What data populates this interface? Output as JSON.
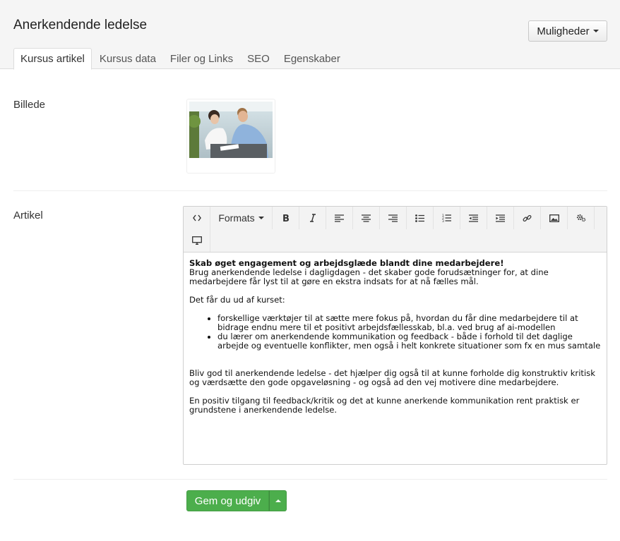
{
  "page": {
    "title": "Anerkendende ledelse",
    "options_label": "Muligheder"
  },
  "tabs": [
    {
      "label": "Kursus artikel",
      "active": true
    },
    {
      "label": "Kursus data"
    },
    {
      "label": "Filer og Links"
    },
    {
      "label": "SEO"
    },
    {
      "label": "Egenskaber"
    }
  ],
  "fields": {
    "image_label": "Billede",
    "article_label": "Artikel"
  },
  "editor": {
    "toolbar": {
      "row1": [
        "code-icon",
        "formats-dropdown",
        "bold-icon",
        "italic-icon",
        "align-left-icon",
        "align-center-icon",
        "align-right-icon",
        "bullet-list-icon",
        "numbered-list-icon",
        "outdent-icon",
        "indent-icon",
        "link-icon",
        "image-icon",
        "settings-icon"
      ],
      "row2": [
        "preview-icon"
      ],
      "formats_label": "Formats"
    },
    "content": {
      "heading": "Skab øget engagement og arbejdsglæde blandt dine medarbejdere!",
      "intro": "Brug anerkendende ledelse i dagligdagen - det skaber gode forudsætninger for, at dine medarbejdere får lyst til at gøre en ekstra indsats for at nå fælles mål.",
      "what_you_get": "Det får du ud af kurset:",
      "bullets": [
        "forskellige værktøjer til at sætte mere fokus på, hvordan du får dine medarbejdere til at bidrage endnu mere til et positivt arbejdsfællesskab, bl.a. ved brug af ai-modellen",
        "du lærer om anerkendende kommunikation og feedback - både i forhold til det daglige arbejde og eventuelle konflikter, men også i helt konkrete situationer som fx en mus samtale"
      ],
      "para1": "Bliv god til anerkendende ledelse - det hjælper dig også til at kunne forholde dig konstruktiv kritisk og værdsætte den gode opgaveløsning - og også ad den vej motivere dine medarbejdere.",
      "para2": "En positiv tilgang til feedback/kritik og det at kunne anerkende kommunikation rent praktisk er grundstene i anerkendende ledelse."
    }
  },
  "actions": {
    "save_label": "Gem og udgiv"
  },
  "colors": {
    "primary_green": "#4cae4c",
    "header_bg": "#f5f5f5"
  }
}
